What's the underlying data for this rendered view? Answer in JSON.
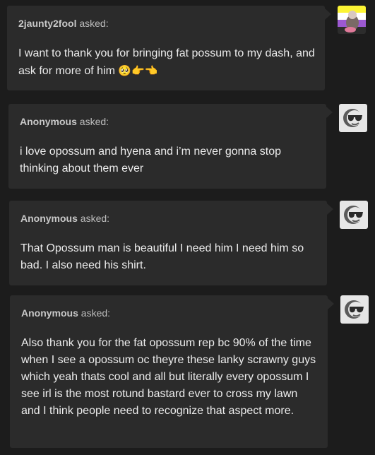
{
  "asks": [
    {
      "asker": "2jaunty2fool",
      "suffix": "asked:",
      "text": "I want to thank you for bringing fat possum to my dash, and ask for more of him",
      "emoji": "🥺👉👈",
      "avatar_icon": "nonbinary-flag-avatar-icon"
    },
    {
      "asker": "Anonymous",
      "suffix": "asked:",
      "text": "i love opossum and hyena and i’m never gonna stop thinking about them ever",
      "avatar_icon": "anonymous-sunglasses-avatar-icon"
    },
    {
      "asker": "Anonymous",
      "suffix": "asked:",
      "text": "That Opossum man is beautiful I need him I need him so bad. I also need his shirt.",
      "avatar_icon": "anonymous-sunglasses-avatar-icon"
    },
    {
      "asker": "Anonymous",
      "suffix": "asked:",
      "text": "Also thank you for the fat opossum rep bc 90% of the time when I see a opossum oc theyre these lanky scrawny guys which yeah thats cool and all but literally every opossum I see irl is the most rotund bastard ever to cross my lawn and I think people need to recognize that aspect more.",
      "avatar_icon": "anonymous-sunglasses-avatar-icon"
    }
  ],
  "colors": {
    "background": "#1c1c1c",
    "card": "#2b2b2b",
    "text": "#ececec",
    "asker": "#bdbdbd"
  }
}
